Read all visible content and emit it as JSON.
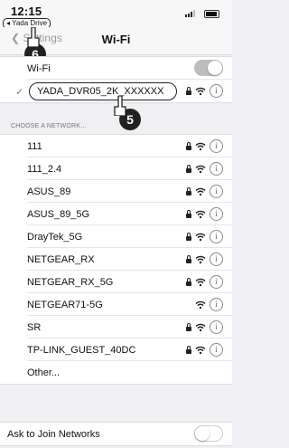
{
  "status_bar": {
    "time": "12:15",
    "back_app": "◂ Yada Drive"
  },
  "nav": {
    "back_label": "Settings",
    "title": "Wi-Fi"
  },
  "wifi": {
    "label": "Wi-Fi",
    "connected_network": "YADA_DVR05_2K_XXXXXX"
  },
  "choose_header": "CHOOSE A NETWORK...",
  "networks": [
    {
      "name": "111",
      "locked": true
    },
    {
      "name": "111_2.4",
      "locked": true
    },
    {
      "name": "ASUS_89",
      "locked": true
    },
    {
      "name": "ASUS_89_5G",
      "locked": true
    },
    {
      "name": "DrayTek_5G",
      "locked": true
    },
    {
      "name": "NETGEAR_RX",
      "locked": true
    },
    {
      "name": "NETGEAR_RX_5G",
      "locked": true
    },
    {
      "name": "NETGEAR71-5G",
      "locked": false
    },
    {
      "name": "SR",
      "locked": true
    },
    {
      "name": "TP-LINK_GUEST_40DC",
      "locked": true
    }
  ],
  "other_label": "Other...",
  "ask_join_label": "Ask to Join Networks",
  "steps": {
    "back_step": "6",
    "network_step": "5"
  }
}
